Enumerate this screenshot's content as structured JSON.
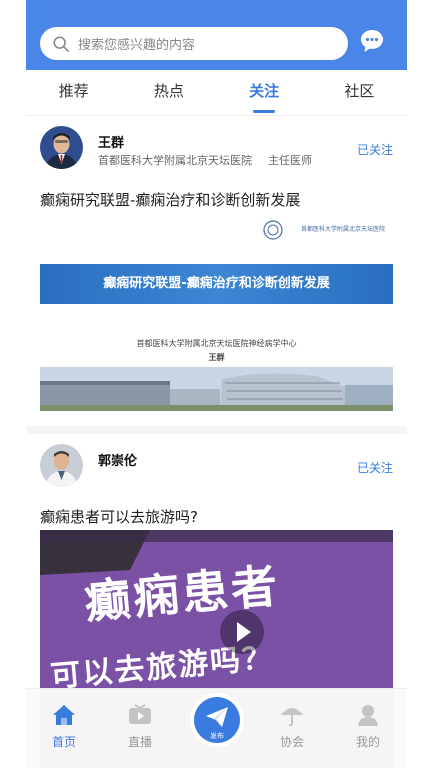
{
  "search": {
    "placeholder": "搜索您感兴趣的内容"
  },
  "tabs": [
    {
      "label": "推荐",
      "active": false
    },
    {
      "label": "热点",
      "active": false
    },
    {
      "label": "关注",
      "active": true
    },
    {
      "label": "社区",
      "active": false
    }
  ],
  "posts": [
    {
      "author": "王群",
      "hospital": "首都医科大学附属北京天坛医院",
      "role": "主任医师",
      "follow_label": "已关注",
      "title": "癫痫研究联盟-癫痫治疗和诊断创新发展",
      "image": {
        "logo_text": "首都医科大学附属北京天坛医院",
        "banner_text": "癫痫研究联盟-癫痫治疗和诊断创新发展",
        "subtitle": "首都医科大学附属北京天坛医院神经病学中心",
        "speaker": "王群"
      }
    },
    {
      "author": "郭崇伦",
      "follow_label": "已关注",
      "title": "癫痫患者可以去旅游吗?",
      "image": {
        "line1": "癫痫患者",
        "line2": "可以去旅游吗？"
      }
    }
  ],
  "bottom_nav": {
    "home": "首页",
    "live": "直播",
    "publish": "发布",
    "association": "协会",
    "mine": "我的"
  },
  "colors": {
    "primary": "#4a86e8",
    "accent": "#3a7be0"
  }
}
